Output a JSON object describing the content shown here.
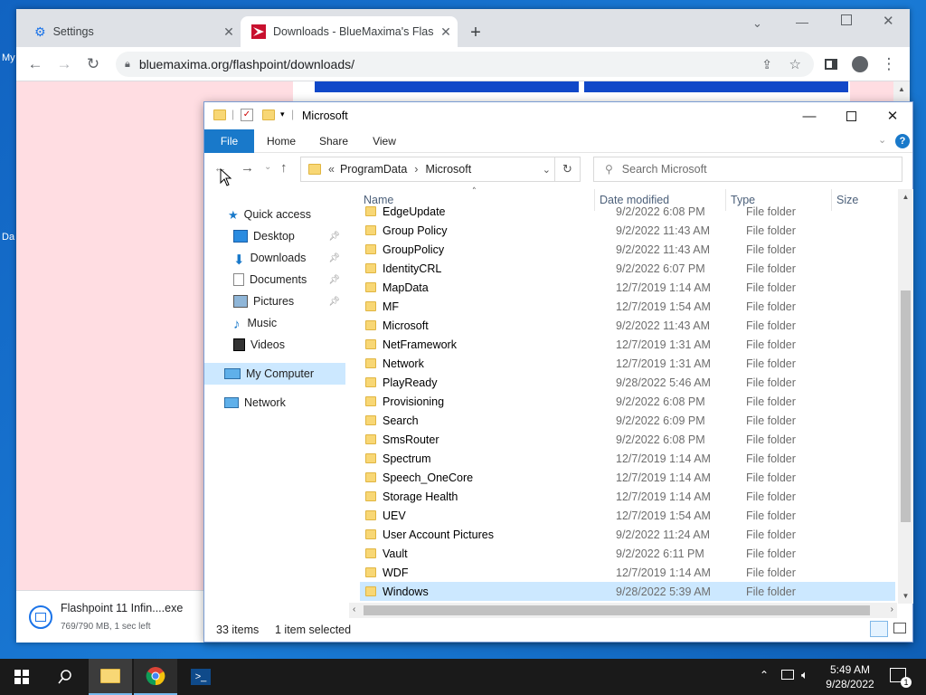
{
  "desktop": {
    "labels": [
      "My",
      "Da"
    ]
  },
  "browser": {
    "tabs": [
      {
        "label": "Settings",
        "icon": "gear-icon"
      },
      {
        "label": "Downloads - BlueMaxima's Flash",
        "icon": "flashpoint-icon"
      }
    ],
    "new_tab": "+",
    "url": "bluemaxima.org/flashpoint/downloads/"
  },
  "download": {
    "filename": "Flashpoint 11 Infin....exe",
    "progress": "769/790 MB, 1 sec left"
  },
  "explorer": {
    "title": "Microsoft",
    "ribbon_tabs": [
      "File",
      "Home",
      "Share",
      "View"
    ],
    "breadcrumb": {
      "prefix": "«",
      "parts": [
        "ProgramData",
        "Microsoft"
      ]
    },
    "search_placeholder": "Search Microsoft",
    "columns": [
      "Name",
      "Date modified",
      "Type",
      "Size"
    ],
    "nav": {
      "quick_access": "Quick access",
      "pinned": [
        "Desktop",
        "Downloads",
        "Documents",
        "Pictures"
      ],
      "libs": [
        "Music",
        "Videos"
      ],
      "my_computer": "My Computer",
      "network": "Network"
    },
    "files": [
      {
        "name": "EdgeUpdate",
        "date": "9/2/2022 6:08 PM",
        "type": "File folder"
      },
      {
        "name": "Group Policy",
        "date": "9/2/2022 11:43 AM",
        "type": "File folder"
      },
      {
        "name": "GroupPolicy",
        "date": "9/2/2022 11:43 AM",
        "type": "File folder"
      },
      {
        "name": "IdentityCRL",
        "date": "9/2/2022 6:07 PM",
        "type": "File folder"
      },
      {
        "name": "MapData",
        "date": "12/7/2019 1:14 AM",
        "type": "File folder"
      },
      {
        "name": "MF",
        "date": "12/7/2019 1:54 AM",
        "type": "File folder"
      },
      {
        "name": "Microsoft",
        "date": "9/2/2022 11:43 AM",
        "type": "File folder"
      },
      {
        "name": "NetFramework",
        "date": "12/7/2019 1:31 AM",
        "type": "File folder"
      },
      {
        "name": "Network",
        "date": "12/7/2019 1:31 AM",
        "type": "File folder"
      },
      {
        "name": "PlayReady",
        "date": "9/28/2022 5:46 AM",
        "type": "File folder"
      },
      {
        "name": "Provisioning",
        "date": "9/2/2022 6:08 PM",
        "type": "File folder"
      },
      {
        "name": "Search",
        "date": "9/2/2022 6:09 PM",
        "type": "File folder"
      },
      {
        "name": "SmsRouter",
        "date": "9/2/2022 6:08 PM",
        "type": "File folder"
      },
      {
        "name": "Spectrum",
        "date": "12/7/2019 1:14 AM",
        "type": "File folder"
      },
      {
        "name": "Speech_OneCore",
        "date": "12/7/2019 1:14 AM",
        "type": "File folder"
      },
      {
        "name": "Storage Health",
        "date": "12/7/2019 1:14 AM",
        "type": "File folder"
      },
      {
        "name": "UEV",
        "date": "12/7/2019 1:54 AM",
        "type": "File folder"
      },
      {
        "name": "User Account Pictures",
        "date": "9/2/2022 11:24 AM",
        "type": "File folder"
      },
      {
        "name": "Vault",
        "date": "9/2/2022 6:11 PM",
        "type": "File folder"
      },
      {
        "name": "WDF",
        "date": "12/7/2019 1:14 AM",
        "type": "File folder"
      },
      {
        "name": "Windows",
        "date": "9/28/2022 5:39 AM",
        "type": "File folder",
        "selected": true
      }
    ],
    "status": {
      "count": "33 items",
      "selected": "1 item selected"
    }
  },
  "taskbar": {
    "time": "5:49 AM",
    "date": "9/28/2022",
    "notifications": "1"
  },
  "colors": {
    "accent": "#1979ca",
    "selection": "#cce8ff",
    "pink": "#ffdde2",
    "bluebar": "#1048c8",
    "folder": "#f8d775"
  }
}
